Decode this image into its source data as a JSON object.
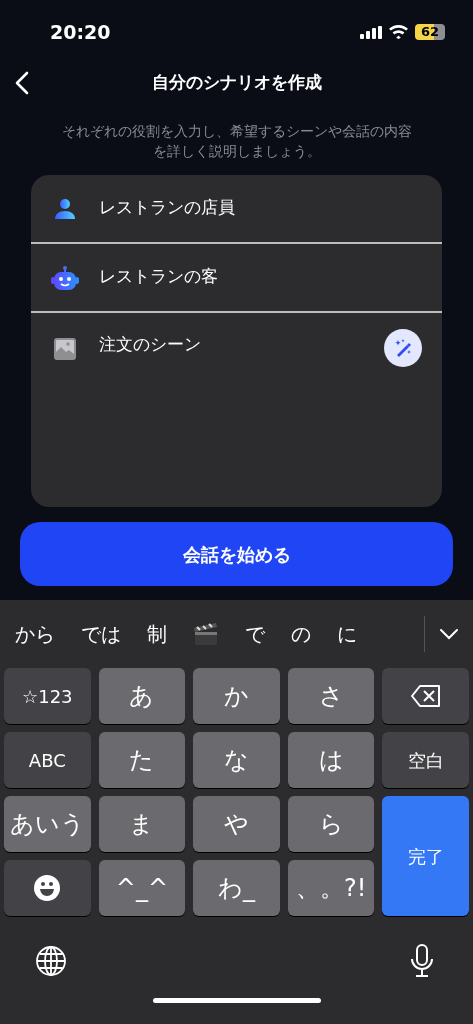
{
  "status_bar": {
    "time": "20:20",
    "battery": "62"
  },
  "header": {
    "title": "自分のシナリオを作成"
  },
  "description": "それぞれの役割を入力し、希望するシーンや会話の内容を詳しく説明しましょう。",
  "card": {
    "fields": [
      {
        "kind": "person",
        "value": "レストランの店員"
      },
      {
        "kind": "robot",
        "value": "レストランの客"
      },
      {
        "kind": "scene",
        "value": "注文のシーン"
      }
    ]
  },
  "start_button": "会話を始める",
  "keyboard": {
    "suggestions": [
      {
        "kind": "text",
        "text": "から"
      },
      {
        "kind": "text",
        "text": "では"
      },
      {
        "kind": "text",
        "text": "制"
      },
      {
        "kind": "emoji"
      },
      {
        "kind": "text",
        "text": "で"
      },
      {
        "kind": "text",
        "text": "の"
      },
      {
        "kind": "text",
        "text": "に"
      }
    ],
    "keys": [
      {
        "kind": "dark",
        "label": "☆123"
      },
      {
        "kind": "light",
        "label": "あ"
      },
      {
        "kind": "light",
        "label": "か"
      },
      {
        "kind": "light",
        "label": "さ"
      },
      {
        "kind": "delete"
      },
      {
        "kind": "dark",
        "label": "ABC"
      },
      {
        "kind": "light",
        "label": "た"
      },
      {
        "kind": "light",
        "label": "な"
      },
      {
        "kind": "light",
        "label": "は"
      },
      {
        "kind": "dark",
        "label": "空白"
      },
      {
        "kind": "light",
        "label": "あいう"
      },
      {
        "kind": "light",
        "label": "ま"
      },
      {
        "kind": "light",
        "label": "や"
      },
      {
        "kind": "light",
        "label": "ら"
      },
      {
        "kind": "done",
        "label": "完了"
      },
      {
        "kind": "emoji"
      },
      {
        "kind": "light",
        "label": "^_^"
      },
      {
        "kind": "light",
        "label": "わ_"
      },
      {
        "kind": "light",
        "label": "、。?!"
      }
    ]
  }
}
